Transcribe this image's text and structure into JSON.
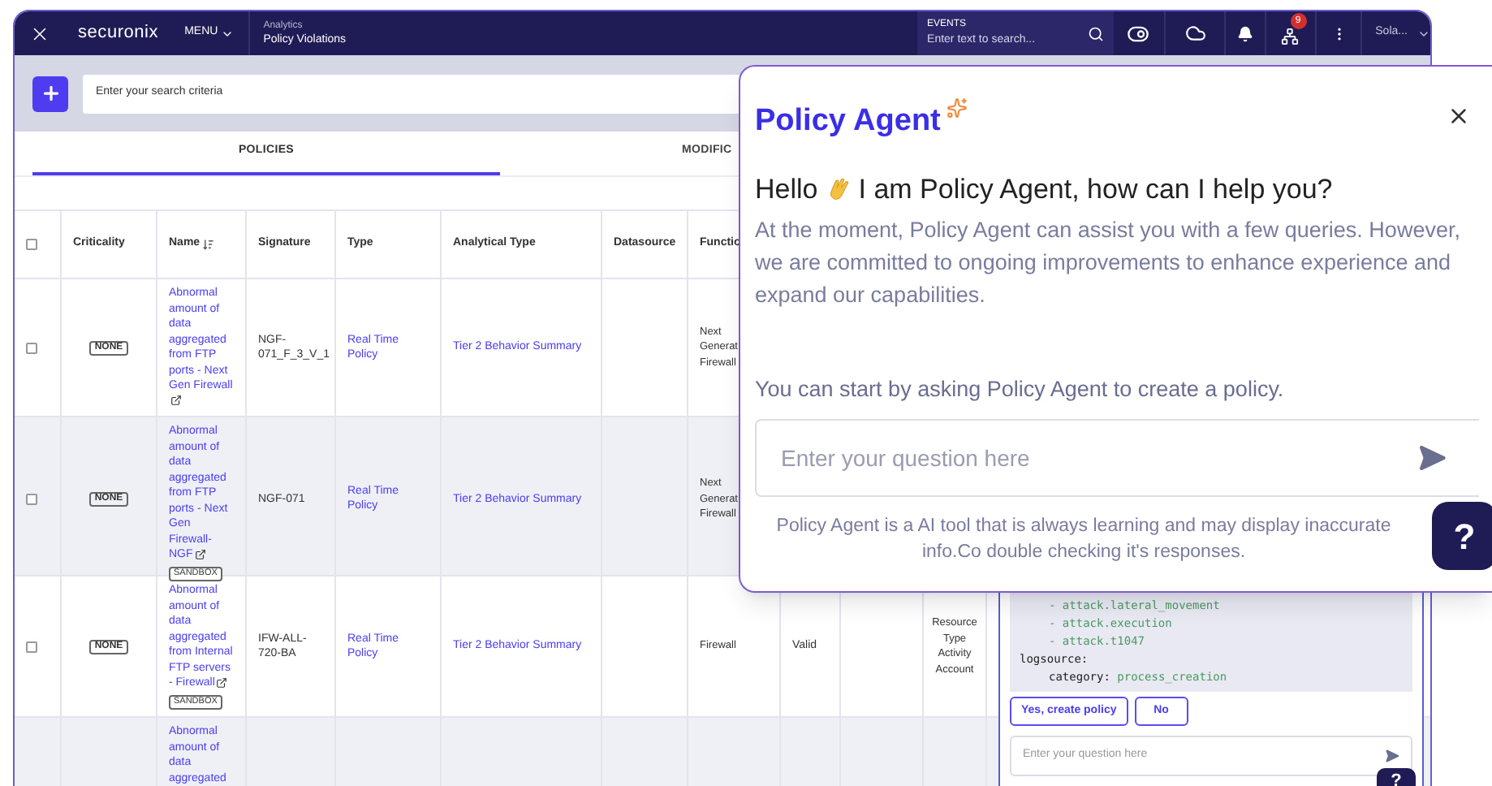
{
  "topbar": {
    "logo": "securonix",
    "menu": "MENU",
    "section": "Analytics",
    "page": "Policy Violations",
    "events_label": "EVENTS",
    "events_placeholder": "Enter text to search...",
    "notification_count": "9",
    "user": "Sola..."
  },
  "search": {
    "placeholder": "Enter your search criteria"
  },
  "tabs": [
    {
      "label": "POLICIES",
      "selected": true
    },
    {
      "label": "MODIFIC",
      "selected": false
    }
  ],
  "table": {
    "select_all": {
      "checked": false
    },
    "columns": [
      "Criticality",
      "Name",
      "Signature",
      "Type",
      "Analytical Type",
      "Datasource",
      "Functio"
    ],
    "rows": [
      {
        "checked": false,
        "criticality": "NONE",
        "name": "Abnormal amount of data aggregated from FTP ports - Next Gen Firewall",
        "signature": "NGF-071_F_3_V_1",
        "type": "Real Time Policy",
        "analytical_type": "Tier 2 Behavior Summary",
        "function": "Next Generat Firewall"
      },
      {
        "checked": false,
        "criticality": "NONE",
        "name": "Abnormal amount of data aggregated from FTP ports - Next Gen Firewall-NGF",
        "tag": "SANDBOX",
        "signature": "NGF-071",
        "type": "Real Time Policy",
        "analytical_type": "Tier 2 Behavior Summary",
        "function": "Next Generat Firewall"
      },
      {
        "checked": false,
        "criticality": "NONE",
        "name": "Abnormal amount of data aggregated from Internal FTP servers - Firewall",
        "tag": "SANDBOX",
        "signature": "IFW-ALL-720-BA",
        "type": "Real Time Policy",
        "analytical_type": "Tier 2 Behavior Summary",
        "function": "Firewall",
        "column_8": "Valid",
        "column_10": "Resource Type Activity Account"
      },
      {
        "name": "Abnormal amount of data aggregated"
      }
    ]
  },
  "chat_panel": {
    "code_lines": [
      {
        "kind": "list",
        "text": "- attack.lateral_movement"
      },
      {
        "kind": "list",
        "text": "- attack.execution"
      },
      {
        "kind": "list",
        "text": "- attack.t1047"
      },
      {
        "kind": "key",
        "text": "logsource:"
      },
      {
        "kind": "pair",
        "key": "category:",
        "value": "process_creation"
      }
    ],
    "buttons": [
      "Yes, create policy",
      "No"
    ],
    "placeholder": "Enter your question here",
    "help": "?"
  },
  "agent_popup": {
    "title": "Policy Agent",
    "greeting_before": "Hello",
    "greeting_after": "I am Policy Agent, how can I help you?",
    "intro": "At the moment, Policy Agent can assist you with a few queries. However, we are committed to ongoing improvements to enhance experience and expand our capabilities.",
    "prompt": "You can start by asking Policy Agent to create a policy.",
    "placeholder": "Enter your question here",
    "disclaimer": "Policy Agent is a AI tool that is always learning and may display inaccurate info.Co double checking it's responses.",
    "help": "?"
  }
}
